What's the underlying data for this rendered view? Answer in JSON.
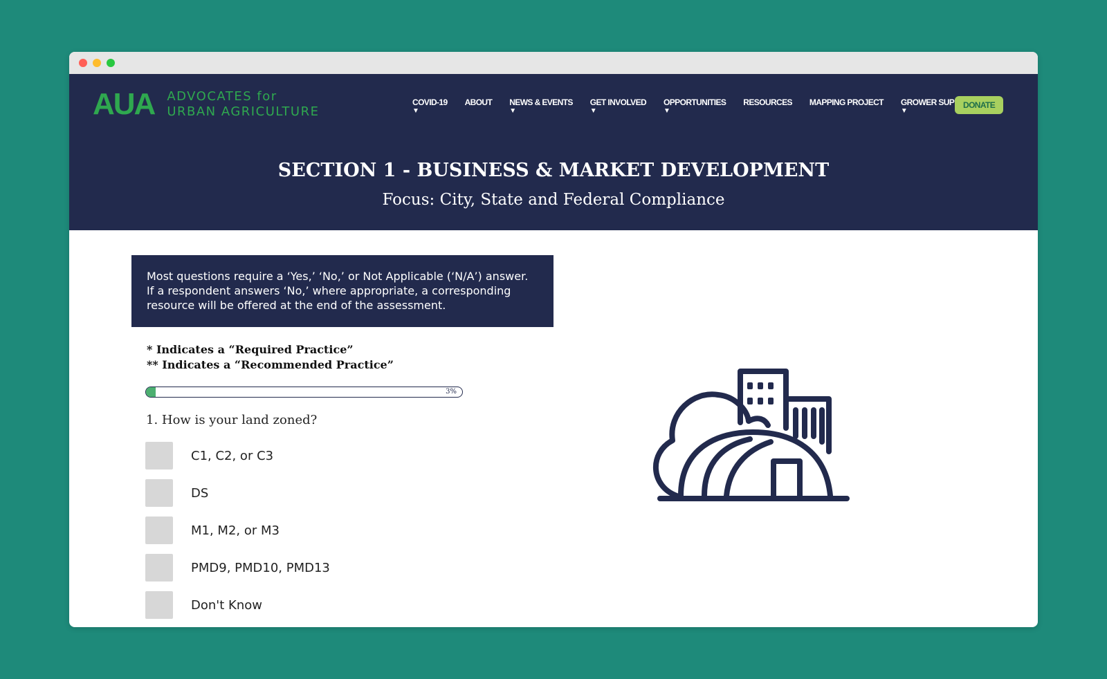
{
  "logo": {
    "mark": "AUA",
    "line1": "ADVOCATES for",
    "line2": "URBAN AGRICULTURE"
  },
  "nav": {
    "items": [
      {
        "label": "COVID-19",
        "has_dropdown": true
      },
      {
        "label": "ABOUT",
        "has_dropdown": false
      },
      {
        "label": "NEWS & EVENTS",
        "has_dropdown": true
      },
      {
        "label": "GET INVOLVED",
        "has_dropdown": true
      },
      {
        "label": "OPPORTUNITIES",
        "has_dropdown": true
      },
      {
        "label": "RESOURCES",
        "has_dropdown": false
      },
      {
        "label": "MAPPING PROJECT",
        "has_dropdown": false
      },
      {
        "label": "GROWER SUPPORT",
        "has_dropdown": true
      }
    ],
    "caret": "▼",
    "donate_label": "DONATE"
  },
  "hero": {
    "title": "SECTION 1 - BUSINESS & MARKET DEVELOPMENT",
    "subtitle": "Focus: City, State and Federal Compliance"
  },
  "info_box": {
    "text": "Most questions require a ‘Yes,’ ‘No,’ or Not Applicable (‘N/A’) answer. If a respondent answers ‘No,’ where appropriate, a corresponding resource will be offered at the end of the assessment."
  },
  "legend": {
    "required": "* Indicates a “Required Practice”",
    "recommended": "** Indicates a “Recommended Practice”"
  },
  "progress": {
    "percent": 3,
    "label": "3%"
  },
  "question": {
    "text": "1. How is your land zoned?",
    "options": [
      "C1, C2, or C3",
      "DS",
      "M1, M2, or M3",
      "PMD9, PMD10, PMD13",
      "Don't Know"
    ]
  },
  "colors": {
    "page_bg": "#1e8a7a",
    "navy": "#222a4d",
    "brand_green": "#2fa84f",
    "donate_bg": "#a8d05f",
    "progress_fill": "#4caf70",
    "checkbox": "#d7d7d7"
  },
  "icons": {
    "illustration": "greenhouse-city-icon"
  }
}
